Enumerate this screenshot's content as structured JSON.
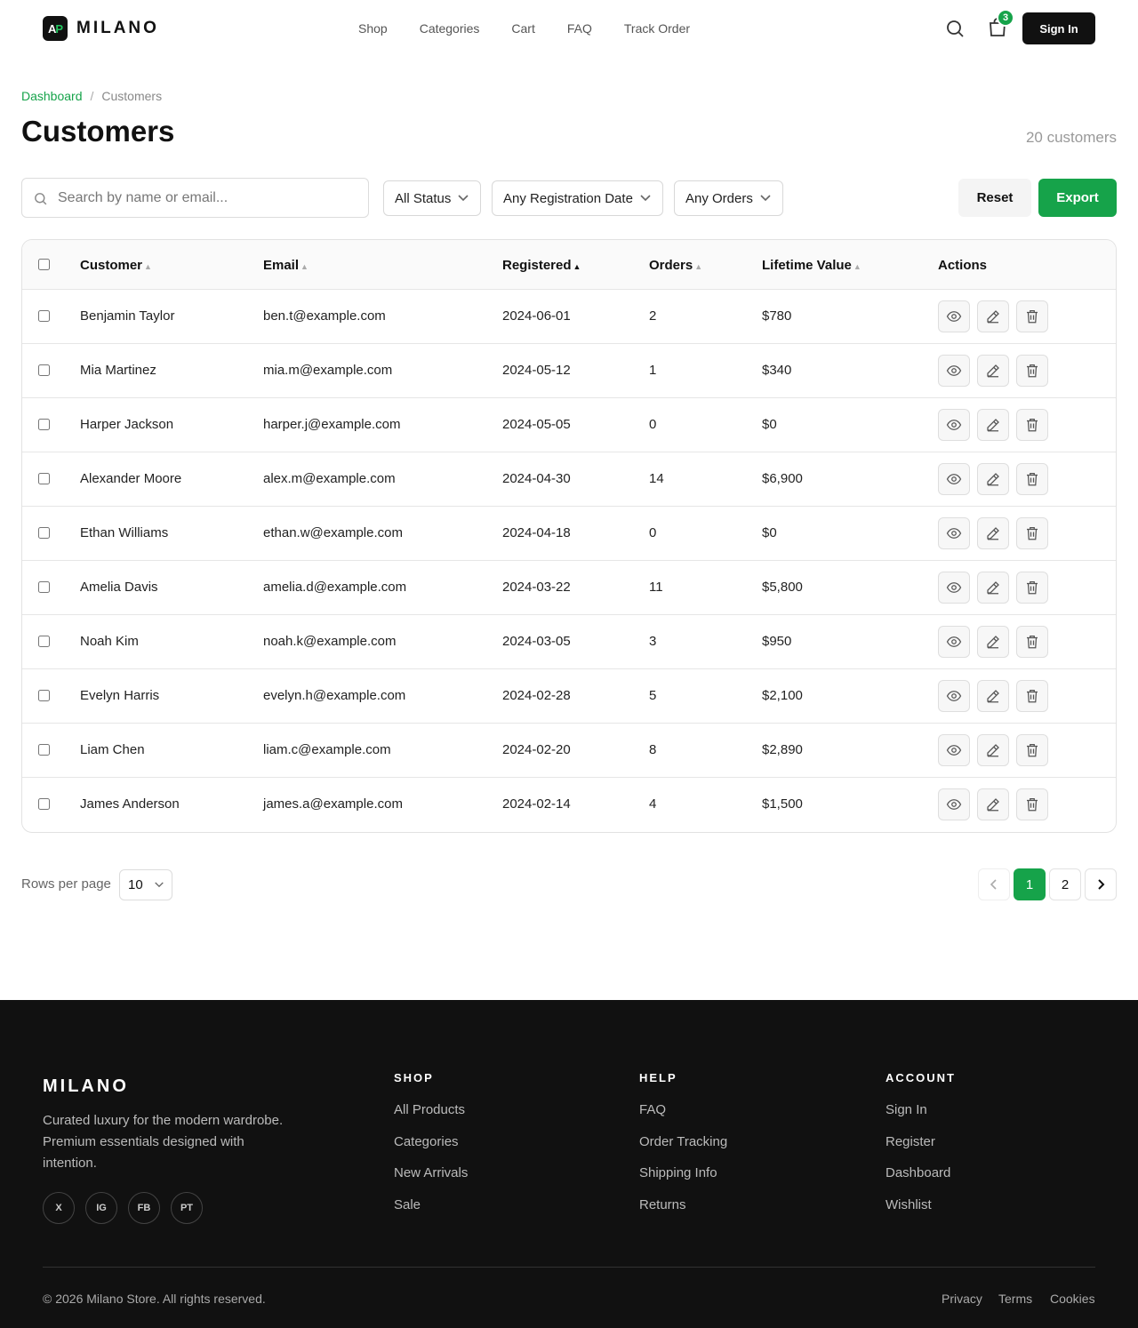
{
  "brand": {
    "name": "MILANO",
    "mark_a": "A",
    "mark_p": "P"
  },
  "nav": {
    "items": [
      "Shop",
      "Categories",
      "Cart",
      "FAQ",
      "Track Order"
    ]
  },
  "header": {
    "cart_count": "3",
    "signin_label": "Sign In"
  },
  "breadcrumb": {
    "parent": "Dashboard",
    "separator": "/",
    "current": "Customers"
  },
  "page": {
    "title": "Customers",
    "count": "20 customers"
  },
  "filters": {
    "search_placeholder": "Search by name or email...",
    "status": "All Status",
    "registration": "Any Registration Date",
    "orders": "Any Orders",
    "reset_label": "Reset",
    "export_label": "Export"
  },
  "table": {
    "columns": [
      "Customer",
      "Email",
      "Registered",
      "Orders",
      "Lifetime Value",
      "Actions"
    ],
    "rows": [
      [
        "Benjamin Taylor",
        "ben.t@example.com",
        "2024-06-01",
        "2",
        "$780"
      ],
      [
        "Mia Martinez",
        "mia.m@example.com",
        "2024-05-12",
        "1",
        "$340"
      ],
      [
        "Harper Jackson",
        "harper.j@example.com",
        "2024-05-05",
        "0",
        "$0"
      ],
      [
        "Alexander Moore",
        "alex.m@example.com",
        "2024-04-30",
        "14",
        "$6,900"
      ],
      [
        "Ethan Williams",
        "ethan.w@example.com",
        "2024-04-18",
        "0",
        "$0"
      ],
      [
        "Amelia Davis",
        "amelia.d@example.com",
        "2024-03-22",
        "11",
        "$5,800"
      ],
      [
        "Noah Kim",
        "noah.k@example.com",
        "2024-03-05",
        "3",
        "$950"
      ],
      [
        "Evelyn Harris",
        "evelyn.h@example.com",
        "2024-02-28",
        "5",
        "$2,100"
      ],
      [
        "Liam Chen",
        "liam.c@example.com",
        "2024-02-20",
        "8",
        "$2,890"
      ],
      [
        "James Anderson",
        "james.a@example.com",
        "2024-02-14",
        "4",
        "$1,500"
      ]
    ],
    "sorted_column": "Registered",
    "row_actions": [
      "eye-icon",
      "pencil-icon",
      "trash-icon"
    ]
  },
  "pagination": {
    "rows_label": "Rows per page",
    "rows_value": "10",
    "pages": [
      "1",
      "2"
    ],
    "current_page": "1"
  },
  "footer": {
    "brand": "MILANO",
    "tagline": "Curated luxury for the modern wardrobe. Premium essentials designed with intention.",
    "social": [
      "X",
      "IG",
      "FB",
      "PT"
    ],
    "columns": [
      {
        "title": "SHOP",
        "links": [
          "All Products",
          "Categories",
          "New Arrivals",
          "Sale"
        ]
      },
      {
        "title": "HELP",
        "links": [
          "FAQ",
          "Order Tracking",
          "Shipping Info",
          "Returns"
        ]
      },
      {
        "title": "ACCOUNT",
        "links": [
          "Sign In",
          "Register",
          "Dashboard",
          "Wishlist"
        ]
      }
    ],
    "copyright": "© 2026 Milano Store. All rights reserved.",
    "legal": [
      "Privacy",
      "Terms",
      "Cookies"
    ]
  },
  "colors": {
    "accent": "#16a34a",
    "dark": "#111111"
  }
}
